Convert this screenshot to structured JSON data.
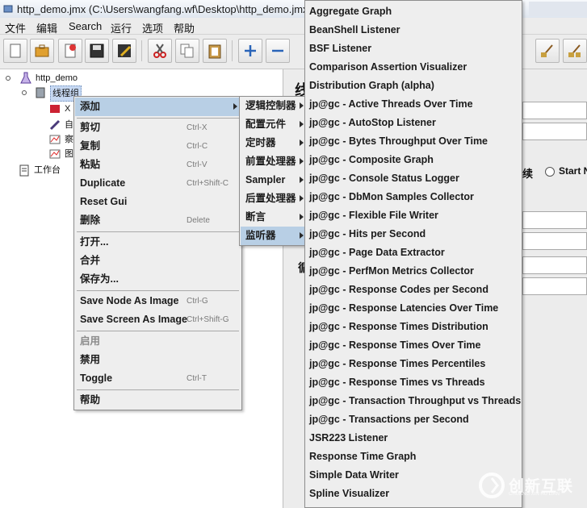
{
  "window": {
    "title": "http_demo.jmx (C:\\Users\\wangfang.wf\\Desktop\\http_demo.jmx"
  },
  "menubar": [
    "文件",
    "编辑",
    "Search",
    "运行",
    "选项",
    "帮助"
  ],
  "tree": {
    "root": "http_demo",
    "thread_group": "线程组",
    "child1": "X",
    "child2": "自",
    "child3": "察",
    "child4": "图",
    "workbench": "工作台"
  },
  "right_panel": {
    "title_char": "线",
    "continue_label": "续",
    "start_next_label": "Start N",
    "loop_char": "循"
  },
  "context_menu": {
    "items": [
      {
        "label": "添加",
        "shortcut": "",
        "submenu": true
      },
      {
        "label": "剪切",
        "shortcut": "Ctrl-X"
      },
      {
        "label": "复制",
        "shortcut": "Ctrl-C"
      },
      {
        "label": "粘贴",
        "shortcut": "Ctrl-V"
      },
      {
        "label": "Duplicate",
        "shortcut": "Ctrl+Shift-C"
      },
      {
        "label": "Reset Gui",
        "shortcut": ""
      },
      {
        "label": "删除",
        "shortcut": "Delete"
      },
      {
        "label": "打开...",
        "shortcut": ""
      },
      {
        "label": "合并",
        "shortcut": ""
      },
      {
        "label": "保存为...",
        "shortcut": ""
      },
      {
        "label": "Save Node As Image",
        "shortcut": "Ctrl-G"
      },
      {
        "label": "Save Screen As Image",
        "shortcut": "Ctrl+Shift-G"
      },
      {
        "label": "启用",
        "shortcut": ""
      },
      {
        "label": "禁用",
        "shortcut": ""
      },
      {
        "label": "Toggle",
        "shortcut": "Ctrl-T"
      },
      {
        "label": "帮助",
        "shortcut": ""
      }
    ]
  },
  "add_submenu": {
    "items": [
      "逻辑控制器",
      "配置元件",
      "定时器",
      "前置处理器",
      "Sampler",
      "后置处理器",
      "断言",
      "监听器"
    ]
  },
  "listener_submenu": {
    "items": [
      "Aggregate Graph",
      "BeanShell Listener",
      "BSF Listener",
      "Comparison Assertion Visualizer",
      "Distribution Graph (alpha)",
      "jp@gc - Active Threads Over Time",
      "jp@gc - AutoStop Listener",
      "jp@gc - Bytes Throughput Over Time",
      "jp@gc - Composite Graph",
      "jp@gc - Console Status Logger",
      "jp@gc - DbMon Samples Collector",
      "jp@gc - Flexible File Writer",
      "jp@gc - Hits per Second",
      "jp@gc - Page Data Extractor",
      "jp@gc - PerfMon Metrics Collector",
      "jp@gc - Response Codes per Second",
      "jp@gc - Response Latencies Over Time",
      "jp@gc - Response Times Distribution",
      "jp@gc - Response Times Over Time",
      "jp@gc - Response Times Percentiles",
      "jp@gc - Response Times vs Threads",
      "jp@gc - Transaction Throughput vs Threads",
      "jp@gc - Transactions per Second",
      "JSR223 Listener",
      "Response Time Graph",
      "Simple Data Writer",
      "Spline Visualizer"
    ]
  },
  "watermark": {
    "text": "创新互联",
    "sub": "CHUANG XIN HU LIAN"
  },
  "colors": {
    "menu_bg": "#EEEEEE",
    "highlight": "#B8CFE5",
    "selection": "#C7D9F3"
  }
}
